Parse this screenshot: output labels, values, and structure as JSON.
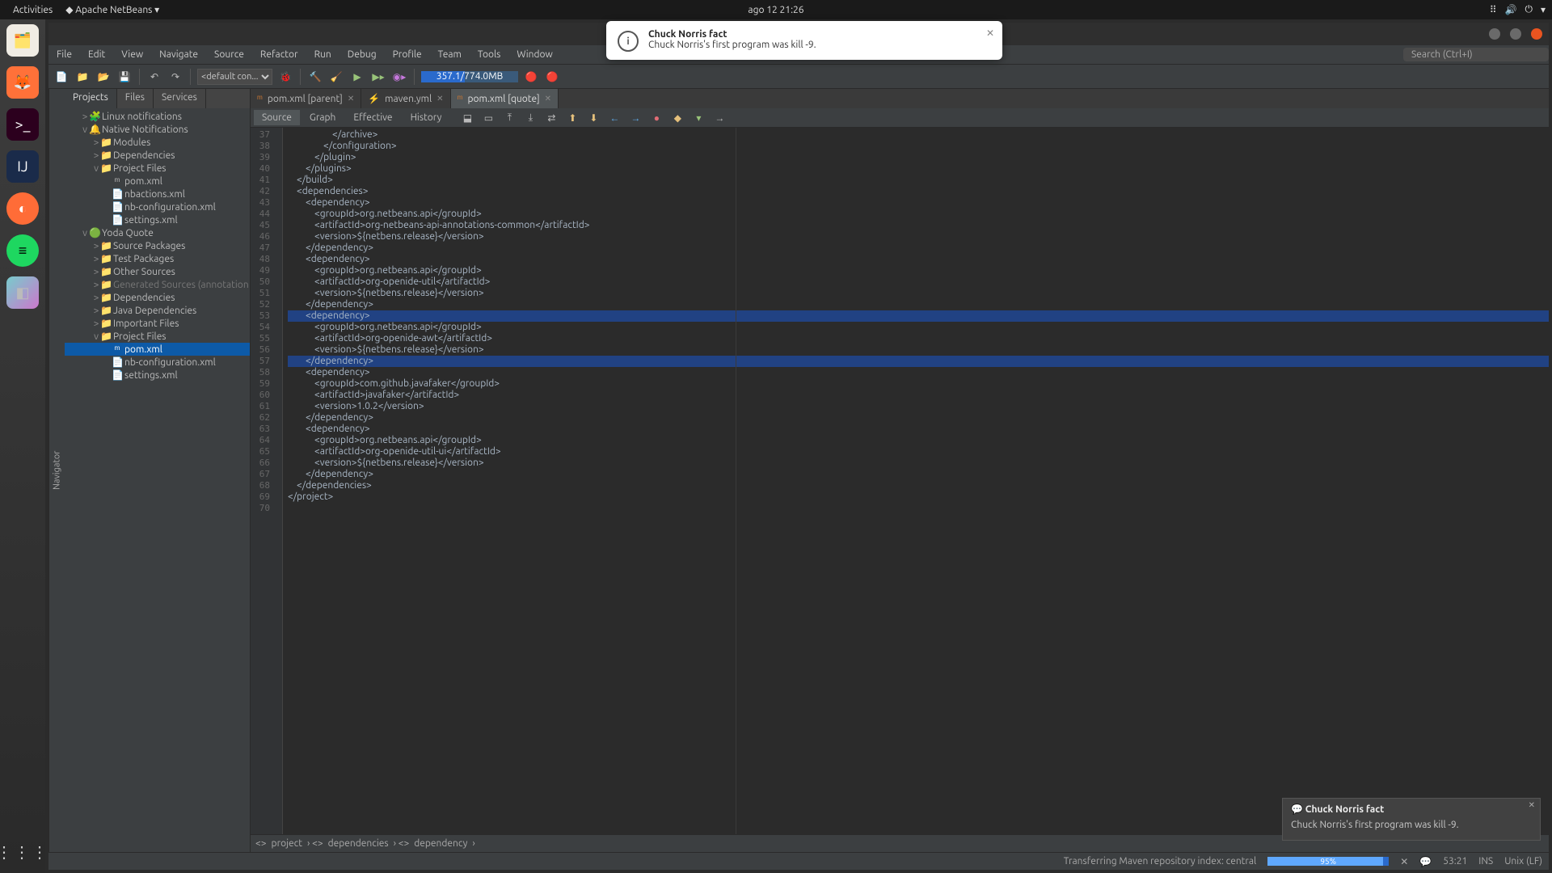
{
  "topbar": {
    "activities": "Activities",
    "app": "Apache NetBeans ▾",
    "clock": "ago 12  21:26"
  },
  "dock": [
    "files",
    "firefox",
    "terminal",
    "intellij",
    "postman",
    "spotify",
    "cube"
  ],
  "window_controls": {
    "min": "#8f8f2a",
    "max": "#8a8a8a",
    "close": "#e95420"
  },
  "menubar": [
    "File",
    "Edit",
    "View",
    "Navigate",
    "Source",
    "Refactor",
    "Run",
    "Debug",
    "Profile",
    "Team",
    "Tools",
    "Window"
  ],
  "search_placeholder": "Search (Ctrl+I)",
  "toolbar": {
    "config": "<default con...",
    "memory": "357.1/774.0MB",
    "memory_pct": 45
  },
  "side_panel_tabs": [
    "Projects",
    "Files",
    "Services"
  ],
  "side_tab_label": "Navigator",
  "tree": [
    {
      "d": 1,
      "t": ">",
      "i": "🧩",
      "l": "Linux notifications"
    },
    {
      "d": 1,
      "t": "v",
      "i": "🔔",
      "l": "Native Notifications"
    },
    {
      "d": 2,
      "t": ">",
      "i": "📁",
      "l": "Modules"
    },
    {
      "d": 2,
      "t": ">",
      "i": "📁",
      "l": "Dependencies"
    },
    {
      "d": 2,
      "t": "v",
      "i": "📁",
      "l": "Project Files"
    },
    {
      "d": 3,
      "t": "",
      "i": "ᵐ",
      "l": "pom.xml"
    },
    {
      "d": 3,
      "t": "",
      "i": "📄",
      "l": "nbactions.xml"
    },
    {
      "d": 3,
      "t": "",
      "i": "📄",
      "l": "nb-configuration.xml"
    },
    {
      "d": 3,
      "t": "",
      "i": "📄",
      "l": "settings.xml"
    },
    {
      "d": 1,
      "t": "v",
      "i": "🟢",
      "l": "Yoda Quote"
    },
    {
      "d": 2,
      "t": ">",
      "i": "📁",
      "l": "Source Packages"
    },
    {
      "d": 2,
      "t": ">",
      "i": "📁",
      "l": "Test Packages"
    },
    {
      "d": 2,
      "t": ">",
      "i": "📁",
      "l": "Other Sources"
    },
    {
      "d": 2,
      "t": ">",
      "i": "📁",
      "l": "Generated Sources (annotation",
      "dim": true
    },
    {
      "d": 2,
      "t": ">",
      "i": "📁",
      "l": "Dependencies"
    },
    {
      "d": 2,
      "t": ">",
      "i": "📁",
      "l": "Java Dependencies"
    },
    {
      "d": 2,
      "t": ">",
      "i": "📁",
      "l": "Important Files"
    },
    {
      "d": 2,
      "t": "v",
      "i": "📁",
      "l": "Project Files"
    },
    {
      "d": 3,
      "t": "",
      "i": "ᵐ",
      "l": "pom.xml",
      "sel": true
    },
    {
      "d": 3,
      "t": "",
      "i": "📄",
      "l": "nb-configuration.xml"
    },
    {
      "d": 3,
      "t": "",
      "i": "📄",
      "l": "settings.xml"
    }
  ],
  "editor_tabs": [
    {
      "icon": "ᵐ",
      "label": "pom.xml [parent]"
    },
    {
      "icon": "⚡",
      "label": "maven.yml"
    },
    {
      "icon": "ᵐ",
      "label": "pom.xml [quote]",
      "active": true
    }
  ],
  "subtabs": [
    "Source",
    "Graph",
    "Effective",
    "History"
  ],
  "lines": {
    "start": 37,
    "end": 70
  },
  "code": [
    "                    </archive>",
    "                </configuration>",
    "            </plugin>",
    "        </plugins>",
    "    </build>",
    "    <dependencies>",
    "        <dependency>",
    "            <groupId>org.netbeans.api</groupId>",
    "            <artifactId>org-netbeans-api-annotations-common</artifactId>",
    "            <version>${netbens.release}</version>",
    "        </dependency>",
    "        <dependency>",
    "            <groupId>org.netbeans.api</groupId>",
    "            <artifactId>org-openide-util</artifactId>",
    "            <version>${netbens.release}</version>",
    "        </dependency>",
    "        <dependency>",
    "            <groupId>org.netbeans.api</groupId>",
    "            <artifactId>org-openide-awt</artifactId>",
    "            <version>${netbens.release}</version>",
    "        </dependency>",
    "        <dependency>",
    "            <groupId>com.github.javafaker</groupId>",
    "            <artifactId>javafaker</artifactId>",
    "            <version>1.0.2</version>",
    "        </dependency>",
    "        <dependency>",
    "            <groupId>org.netbeans.api</groupId>",
    "            <artifactId>org-openide-util-ui</artifactId>",
    "            <version>${netbens.release}</version>",
    "        </dependency>",
    "    </dependencies>",
    "</project>",
    ""
  ],
  "highlight_lines": [
    53,
    57
  ],
  "breadcrumb": [
    "project",
    "dependencies",
    "dependency"
  ],
  "status": {
    "task": "Transferring Maven repository index: central",
    "pct": "95%",
    "pct_num": 95,
    "cursor": "53:21",
    "mode": "INS",
    "enc": "Unix (LF)"
  },
  "sys_notif": {
    "title": "Chuck Norris fact",
    "body": "Chuck Norris's first program was kill -9."
  },
  "ide_notif": {
    "title": "Chuck Norris fact",
    "body": "Chuck Norris's first program was kill -9."
  }
}
